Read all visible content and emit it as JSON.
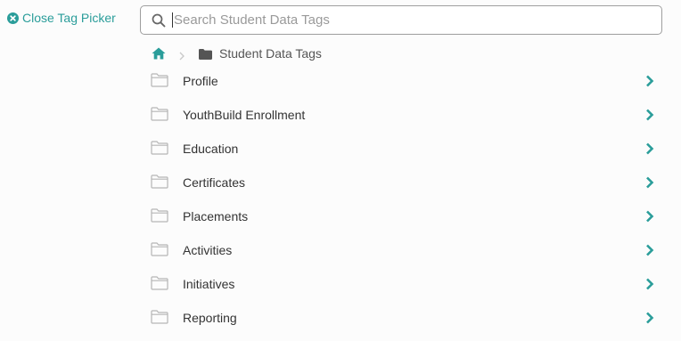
{
  "close_picker": {
    "label": "Close Tag Picker",
    "icon": "close-circle-icon"
  },
  "search": {
    "placeholder": "Search Student Data Tags",
    "value": "",
    "icon": "search-icon"
  },
  "breadcrumb": {
    "home_icon": "home-icon",
    "separator_icon": "chevron-right-icon",
    "folder_icon": "folder-icon",
    "current": "Student Data Tags"
  },
  "folders": [
    {
      "label": "Profile"
    },
    {
      "label": "YouthBuild Enrollment"
    },
    {
      "label": "Education"
    },
    {
      "label": "Certificates"
    },
    {
      "label": "Placements"
    },
    {
      "label": "Activities"
    },
    {
      "label": "Initiatives"
    },
    {
      "label": "Reporting"
    }
  ],
  "colors": {
    "accent": "#2a9d9a",
    "text": "#333333",
    "muted": "#9a9a9a",
    "folder_outline": "#b5b5b5",
    "breadcrumb_folder": "#555555"
  }
}
